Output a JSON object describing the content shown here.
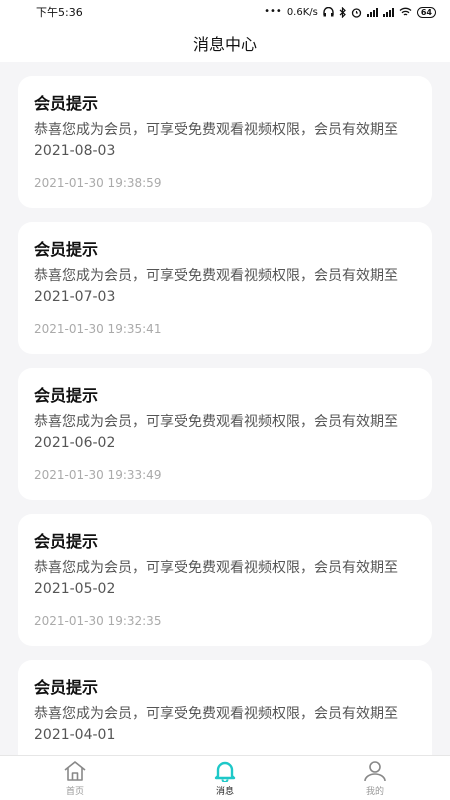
{
  "status_bar": {
    "time": "下午5:36",
    "network_speed": "0.6K/s",
    "battery": "64",
    "icons": [
      "headphone-icon",
      "bluetooth-icon",
      "alarm-icon",
      "signal-icon",
      "wifi-icon",
      "battery-icon"
    ]
  },
  "header": {
    "title": "消息中心"
  },
  "messages": [
    {
      "title": "会员提示",
      "body": "恭喜您成为会员，可享受免费观看视频权限，会员有效期至2021-08-03",
      "time": "2021-01-30 19:38:59"
    },
    {
      "title": "会员提示",
      "body": "恭喜您成为会员，可享受免费观看视频权限，会员有效期至2021-07-03",
      "time": "2021-01-30 19:35:41"
    },
    {
      "title": "会员提示",
      "body": "恭喜您成为会员，可享受免费观看视频权限，会员有效期至2021-06-02",
      "time": "2021-01-30 19:33:49"
    },
    {
      "title": "会员提示",
      "body": "恭喜您成为会员，可享受免费观看视频权限，会员有效期至2021-05-02",
      "time": "2021-01-30 19:32:35"
    },
    {
      "title": "会员提示",
      "body": "恭喜您成为会员，可享受免费观看视频权限，会员有效期至2021-04-01",
      "time": ""
    }
  ],
  "tabbar": {
    "items": [
      {
        "label": "首页",
        "icon": "home-icon",
        "active": false
      },
      {
        "label": "消息",
        "icon": "bell-icon",
        "active": true
      },
      {
        "label": "我的",
        "icon": "user-icon",
        "active": false
      }
    ]
  },
  "colors": {
    "accent": "#1ec8c8",
    "background": "#f5f5f7",
    "card": "#ffffff"
  }
}
